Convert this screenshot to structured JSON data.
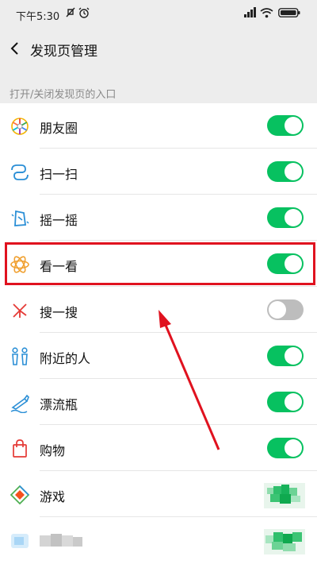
{
  "status_bar": {
    "time": "下午5:30"
  },
  "header": {
    "title": "发现页管理"
  },
  "section_title": "打开/关闭发现页的入口",
  "items": [
    {
      "label": "朋友圈",
      "icon": "moments-icon",
      "state": "on"
    },
    {
      "label": "扫一扫",
      "icon": "scan-icon",
      "state": "on"
    },
    {
      "label": "摇一摇",
      "icon": "shake-icon",
      "state": "on"
    },
    {
      "label": "看一看",
      "icon": "top-stories-icon",
      "state": "on",
      "highlighted": true
    },
    {
      "label": "搜一搜",
      "icon": "search-spark-icon",
      "state": "off"
    },
    {
      "label": "附近的人",
      "icon": "people-nearby-icon",
      "state": "on"
    },
    {
      "label": "漂流瓶",
      "icon": "bottle-icon",
      "state": "on"
    },
    {
      "label": "购物",
      "icon": "shopping-bag-icon",
      "state": "on"
    },
    {
      "label": "游戏",
      "icon": "game-icon",
      "state": "pixelated"
    },
    {
      "label": "",
      "icon": "blurred-app-icon",
      "state": "pixelated"
    }
  ],
  "colors": {
    "accent": "#07c160",
    "toggle_off": "#bdbdbd",
    "highlight": "#e0121f",
    "background": "#ededed"
  }
}
